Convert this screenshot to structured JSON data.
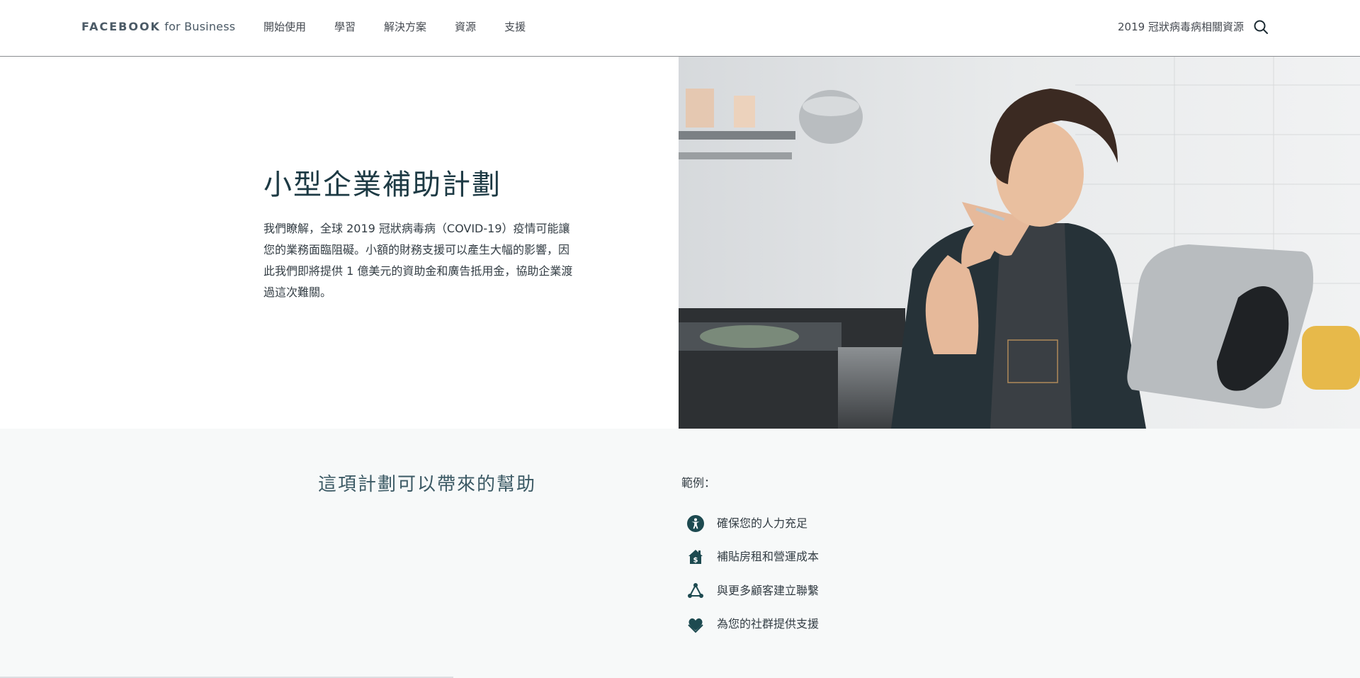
{
  "header": {
    "logo_brand": "FACEBOOK",
    "logo_suffix": " for Business",
    "nav": [
      {
        "label": "開始使用"
      },
      {
        "label": "學習"
      },
      {
        "label": "解決方案"
      },
      {
        "label": "資源"
      },
      {
        "label": "支援"
      }
    ],
    "covid_link": "2019 冠狀病毒病相關資源",
    "search_icon": "search-icon"
  },
  "hero": {
    "title": "小型企業補助計劃",
    "body": "我們瞭解，全球 2019 冠狀病毒病（COVID-19）疫情可能讓您的業務面臨阻礙。小額的財務支援可以產生大幅的影響，因此我們即將提供 1 億美元的資助金和廣告抵用金，協助企業渡過這次難關。"
  },
  "help": {
    "title": "這項計劃可以帶來的幫助",
    "examples_label": "範例：",
    "items": [
      {
        "label": "確保您的人力充足",
        "icon": "accessibility-person-icon"
      },
      {
        "label": "補貼房租和營運成本",
        "icon": "house-dollar-icon"
      },
      {
        "label": "與更多顧客建立聯繫",
        "icon": "network-nodes-icon"
      },
      {
        "label": "為您的社群提供支援",
        "icon": "heart-hand-icon"
      }
    ]
  },
  "colors": {
    "accent": "#1d3a44",
    "icon_teal": "#1d4a50",
    "lower_bg": "#f7f9f9"
  }
}
